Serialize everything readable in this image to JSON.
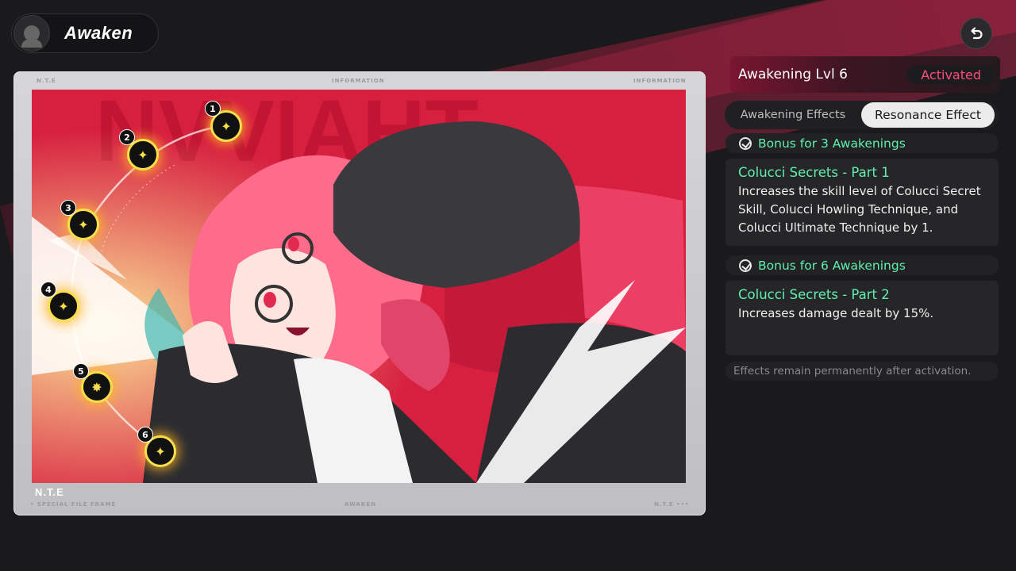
{
  "header": {
    "title": "Awaken"
  },
  "frame": {
    "label_top_left": "N.T.E",
    "label_top_center": "INFORMATION",
    "label_top_right": "INFORMATION",
    "label_bottom_brand": "N.T.E",
    "label_bottom_sub": "• SPECIAL FILE FRAME",
    "label_bottom_center": "AWAKEN",
    "label_bottom_right": "N.T.E •••"
  },
  "nodes": [
    {
      "num": "1"
    },
    {
      "num": "2"
    },
    {
      "num": "3"
    },
    {
      "num": "4"
    },
    {
      "num": "5"
    },
    {
      "num": "6"
    }
  ],
  "panel": {
    "level_title": "Awakening Lvl 6",
    "status": "Activated",
    "tabs": [
      "Awakening Effects",
      "Resonance Effect"
    ],
    "active_tab": "Resonance Effect",
    "bonuses": [
      {
        "header": "Bonus for 3 Awakenings",
        "title": "Colucci Secrets - Part 1",
        "desc": "Increases the skill level of Colucci Secret Skill, Colucci Howling Technique, and Colucci Ultimate Technique by 1."
      },
      {
        "header": "Bonus for 6 Awakenings",
        "title": "Colucci Secrets - Part 2",
        "desc": "Increases damage dealt by 15%."
      }
    ],
    "footnote": "Effects remain permanently after activation."
  },
  "colors": {
    "accent_green": "#5ff0b0",
    "status_pink": "#ff4d7d",
    "node_yellow": "#f6e04a",
    "art_red": "#d71f3f"
  }
}
